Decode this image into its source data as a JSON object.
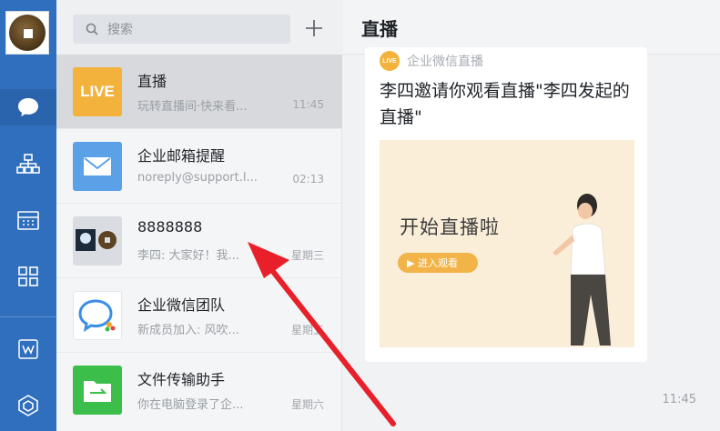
{
  "rail": {
    "nav": [
      "chat-icon",
      "org-chart-icon",
      "calendar-icon",
      "apps-icon",
      "doc-icon",
      "cube-icon"
    ],
    "active_color": "#2f6fbd"
  },
  "search": {
    "placeholder": "搜索"
  },
  "chats": [
    {
      "name": "直播",
      "preview": "玩转直播间·快来看...",
      "time": "11:45",
      "avatar_text": "LIVE",
      "active": true
    },
    {
      "name": "企业邮箱提醒",
      "preview": "noreply@support.l...",
      "time": "02:13"
    },
    {
      "name": "8888888",
      "preview": "李四: 大家好！我...",
      "time": "星期三"
    },
    {
      "name": "企业微信团队",
      "preview": "新成员加入: 风吹...",
      "time": "星期五"
    },
    {
      "name": "文件传输助手",
      "preview": "你在电脑登录了企...",
      "time": "星期六"
    }
  ],
  "main": {
    "title": "直播",
    "card": {
      "badge_text": "LIVE",
      "source": "企业微信直播",
      "text": "李四邀请你观看直播\"李四发起的直播\"",
      "poster_title": "开始直播啦",
      "poster_button": "▶ 进入观看"
    },
    "time": "11:45"
  },
  "colors": {
    "brand": "#2f6fbd",
    "live": "#f3b23b",
    "arrow": "#e8202a"
  }
}
